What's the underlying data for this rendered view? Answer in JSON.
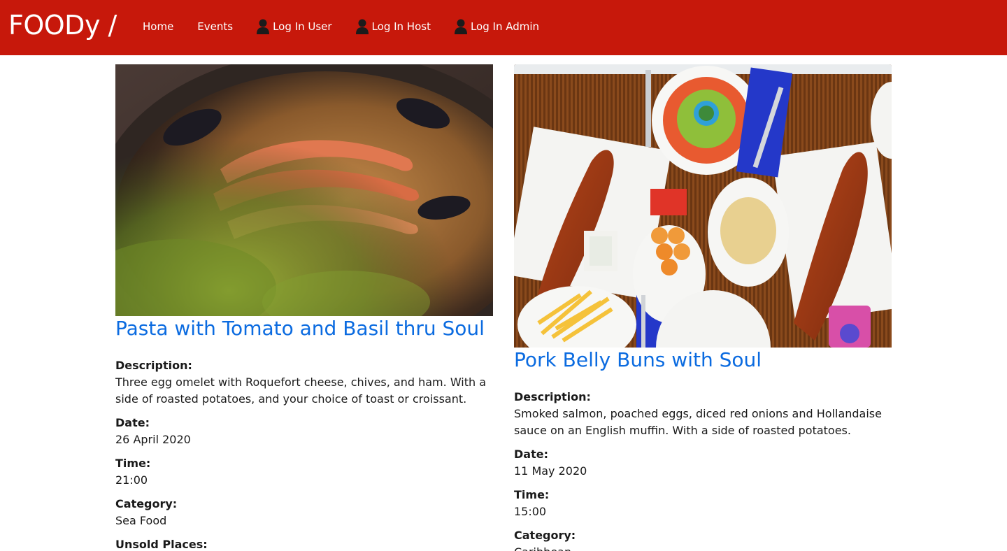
{
  "navbar": {
    "brand": "FOODy /",
    "links": [
      {
        "label": "Home",
        "icon": null
      },
      {
        "label": "Events",
        "icon": null
      },
      {
        "label": "Log In User",
        "icon": "user-icon"
      },
      {
        "label": "Log In Host",
        "icon": "user-icon"
      },
      {
        "label": "Log In Admin",
        "icon": "user-icon"
      }
    ],
    "background_color": "#c7180b"
  },
  "events": [
    {
      "title": "Pasta with Tomato and Basil thru Soul",
      "image": "seafood-paella-photo",
      "fields": [
        {
          "label": "Description:",
          "value": "Three egg omelet with Roquefort cheese, chives, and ham. With a side of roasted potatoes, and your choice of toast or croissant."
        },
        {
          "label": "Date:",
          "value": "26 April 2020"
        },
        {
          "label": "Time:",
          "value": "21:00"
        },
        {
          "label": "Category:",
          "value": "Sea Food"
        },
        {
          "label": "Unsold Places:",
          "value": ""
        }
      ]
    },
    {
      "title": "Pork Belly Buns with Soul",
      "image": "caribbean-fried-fish-platter-photo",
      "fields": [
        {
          "label": "Description:",
          "value": "Smoked salmon, poached eggs, diced red onions and Hollandaise sauce on an English muffin. With a side of roasted potatoes."
        },
        {
          "label": "Date:",
          "value": "11 May 2020"
        },
        {
          "label": "Time:",
          "value": "15:00"
        },
        {
          "label": "Category:",
          "value": "Caribbean"
        }
      ]
    }
  ],
  "colors": {
    "link": "#0b6be0",
    "accent": "#c7180b"
  }
}
